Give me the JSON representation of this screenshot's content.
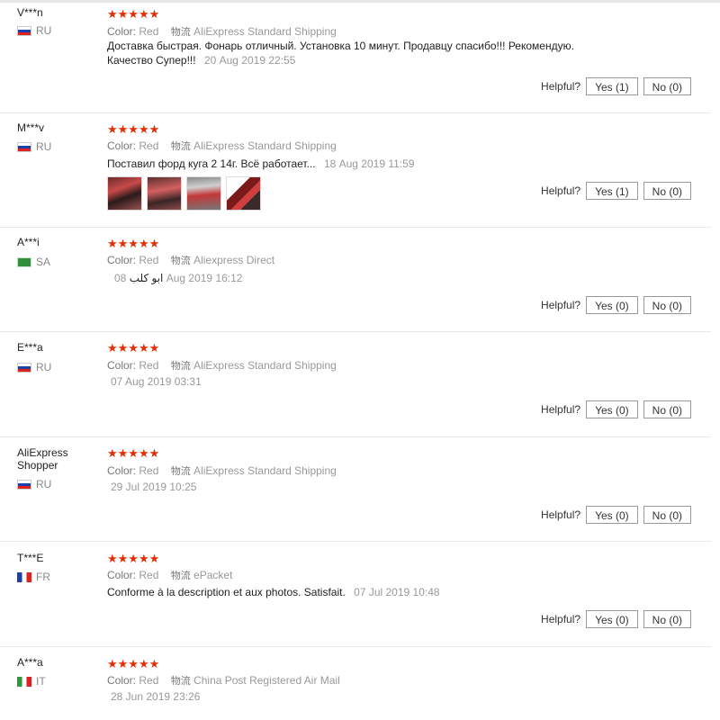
{
  "helpful_label": "Helpful?",
  "color_label": "Color:",
  "logistics_label": "物流",
  "reviews": [
    {
      "user": "V***n",
      "country": "RU",
      "stars": "★★★★★",
      "color": "Red",
      "shipping": "AliExpress Standard Shipping",
      "text": "Доставка быстрая. Фонарь отличный. Установка 10 минут. Продавцу спасибо!!! Рекомендую. Качество Супер!!!",
      "date": "20 Aug 2019 22:55",
      "yes": "Yes (1)",
      "no": "No (0)"
    },
    {
      "user": "M***v",
      "country": "RU",
      "stars": "★★★★★",
      "color": "Red",
      "shipping": "AliExpress Standard Shipping",
      "text": "Поставил форд куга 2 14г. Всё работает...",
      "date": "18 Aug 2019 11:59",
      "yes": "Yes (1)",
      "no": "No (0)"
    },
    {
      "user": "A***i",
      "country": "SA",
      "stars": "★★★★★",
      "color": "Red",
      "shipping": "Aliexpress Direct",
      "text": "ابو كلب",
      "date": "08 Aug 2019 16:12",
      "yes": "Yes (0)",
      "no": "No (0)"
    },
    {
      "user": "E***a",
      "country": "RU",
      "stars": "★★★★★",
      "color": "Red",
      "shipping": "AliExpress Standard Shipping",
      "date": "07 Aug 2019 03:31",
      "yes": "Yes (0)",
      "no": "No (0)"
    },
    {
      "user": "AliExpress Shopper",
      "country": "RU",
      "stars": "★★★★★",
      "color": "Red",
      "shipping": "AliExpress Standard Shipping",
      "date": "29 Jul 2019 10:25",
      "yes": "Yes (0)",
      "no": "No (0)"
    },
    {
      "user": "T***E",
      "country": "FR",
      "stars": "★★★★★",
      "color": "Red",
      "shipping": "ePacket",
      "text": "Conforme à la description et aux photos. Satisfait.",
      "date": "07 Jul 2019 10:48",
      "yes": "Yes (0)",
      "no": "No (0)"
    },
    {
      "user": "A***a",
      "country": "IT",
      "stars": "★★★★★",
      "color": "Red",
      "shipping": "China Post Registered Air Mail",
      "date": "28 Jun 2019 23:26"
    }
  ]
}
